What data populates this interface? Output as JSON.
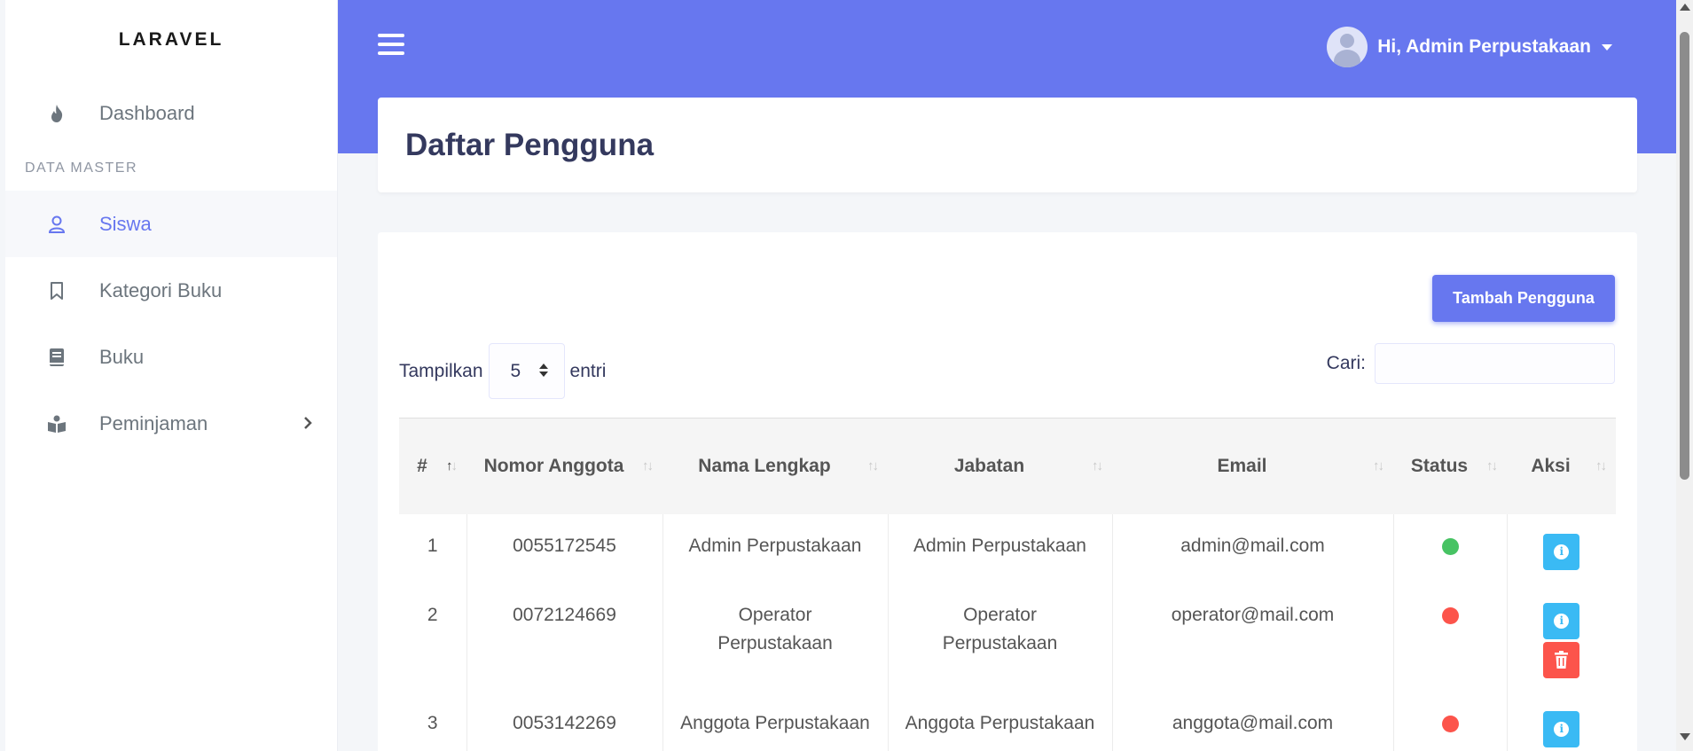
{
  "brand": "LARAVEL",
  "sidebar": {
    "items": [
      {
        "label": "Dashboard",
        "icon": "fire-icon"
      },
      {
        "label": "Siswa",
        "icon": "user-icon"
      },
      {
        "label": "Kategori Buku",
        "icon": "bookmark-icon"
      },
      {
        "label": "Buku",
        "icon": "book-icon"
      },
      {
        "label": "Peminjaman",
        "icon": "book-reader-icon"
      }
    ],
    "section_header": "DATA MASTER"
  },
  "topbar": {
    "user_greeting": "Hi, Admin Perpustakaan"
  },
  "page": {
    "title": "Daftar Pengguna"
  },
  "toolbar": {
    "add_label": "Tambah Pengguna",
    "show_label": "Tampilkan",
    "entries_value": "5",
    "entries_label": "entri",
    "search_label": "Cari:"
  },
  "table": {
    "headers": [
      "#",
      "Nomor Anggota",
      "Nama Lengkap",
      "Jabatan",
      "Email",
      "Status",
      "Aksi"
    ],
    "rows": [
      {
        "no": "1",
        "nomor": "0055172545",
        "nama": "Admin Perpustakaan",
        "jabatan": "Admin Perpustakaan",
        "email": "admin@mail.com",
        "status": "active"
      },
      {
        "no": "2",
        "nomor": "0072124669",
        "nama": "Operator Perpustakaan",
        "jabatan": "Operator Perpustakaan",
        "email": "operator@mail.com",
        "status": "inactive"
      },
      {
        "no": "3",
        "nomor": "0053142269",
        "nama": "Anggota Perpustakaan",
        "jabatan": "Anggota Perpustakaan",
        "email": "anggota@mail.com",
        "status": "inactive"
      }
    ]
  },
  "colors": {
    "primary": "#6777ef",
    "info": "#3abaf4",
    "danger": "#fc544b",
    "success": "#47c363"
  }
}
